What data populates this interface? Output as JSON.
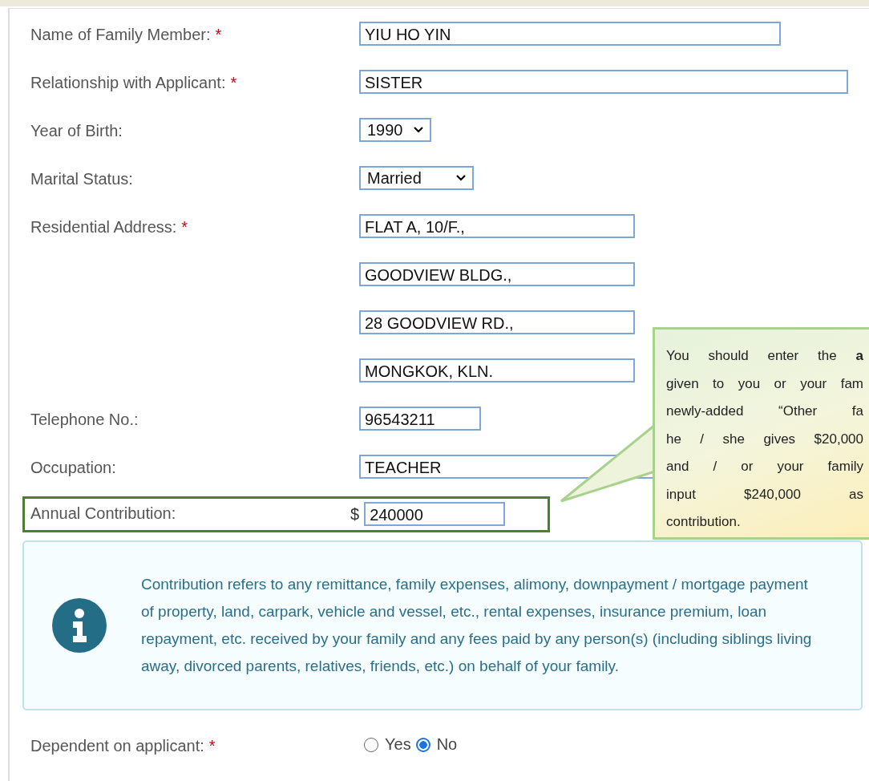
{
  "form": {
    "fields": [
      {
        "kind": "text",
        "label": "Name of Family Member:",
        "required_mark": "*",
        "values": [
          "YIU HO YIN"
        ]
      },
      {
        "kind": "text",
        "label": "Relationship with Applicant:",
        "required_mark": "*",
        "values": [
          "SISTER"
        ]
      },
      {
        "kind": "select",
        "label": "Year of Birth:",
        "values": [
          "1990"
        ]
      },
      {
        "kind": "select",
        "label": "Marital Status:",
        "values": [
          "Married"
        ]
      },
      {
        "kind": "text",
        "label": "Residential Address:",
        "required_mark": "*",
        "values": [
          "FLAT A, 10/F.,",
          "GOODVIEW BLDG.,",
          "28 GOODVIEW RD.,",
          "MONGKOK, KLN."
        ]
      },
      {
        "kind": "text",
        "label": "Telephone No.:",
        "values": [
          "96543211"
        ]
      },
      {
        "kind": "text",
        "label": "Occupation:",
        "values": [
          "TEACHER"
        ]
      },
      {
        "kind": "money",
        "label": "Annual Contribution:",
        "highlighted": true,
        "currency": "$",
        "values": [
          "240000"
        ]
      }
    ],
    "info_note": "Contribution refers to any remittance, family expenses, alimony, downpayment / mortgage payment of property, land, carpark, vehicle and vessel, etc., rental expenses, insurance premium, loan repayment, etc. received by your family and any fees paid by any person(s) (including siblings living away, divorced parents, relatives, friends, etc.) on behalf of your family.",
    "dependent": {
      "label": "Dependent on applicant:",
      "required_mark": "*",
      "options": [
        {
          "label": "Yes",
          "selected": false
        },
        {
          "label": "No",
          "selected": true
        }
      ]
    }
  },
  "callout": {
    "lines": [
      "You should enter the **a**",
      "given to you or your fam",
      "newly-added “Other fa",
      "he / she gives $20,000",
      "and / or your family",
      "input $240,000 as",
      "contribution."
    ]
  }
}
